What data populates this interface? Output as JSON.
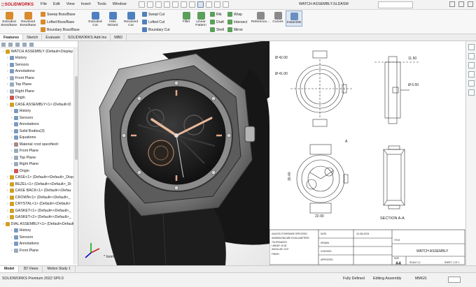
{
  "app": {
    "brand": "SOLIDWORKS",
    "doc_title": "WATCH ASSEMBLY.SLDASM"
  },
  "menu": [
    "File",
    "Edit",
    "View",
    "Insert",
    "Tools",
    "Window"
  ],
  "ribbon": {
    "large": [
      {
        "label": "Extruded Boss/Base",
        "color": "#d98a2c"
      },
      {
        "label": "Revolved Boss/Base",
        "color": "#d98a2c"
      },
      {
        "label": "Extruded Cut",
        "color": "#4f7fbf"
      },
      {
        "label": "Hole Wizard",
        "color": "#4f7fbf"
      },
      {
        "label": "Revolved Cut",
        "color": "#4f7fbf"
      },
      {
        "label": "Fillet",
        "color": "#5a9f5a"
      },
      {
        "label": "Linear Pattern",
        "color": "#5a9f5a"
      },
      {
        "label": "Reference...",
        "color": "#8a8a8a"
      },
      {
        "label": "Curves",
        "color": "#8a8a8a"
      },
      {
        "label": "Instant3D",
        "color": "#6a8fbf"
      }
    ],
    "small": [
      {
        "label": "Sweep Boss/Base",
        "color": "#d98a2c"
      },
      {
        "label": "Lofted Boss/Base",
        "color": "#d98a2c"
      },
      {
        "label": "Boundary Boss/Base",
        "color": "#d98a2c"
      },
      {
        "label": "Swept Cut",
        "color": "#4f7fbf"
      },
      {
        "label": "Lofted Cut",
        "color": "#4f7fbf"
      },
      {
        "label": "Boundary Cut",
        "color": "#4f7fbf"
      },
      {
        "label": "Rib",
        "color": "#5a9f5a"
      },
      {
        "label": "Draft",
        "color": "#5a9f5a"
      },
      {
        "label": "Shell",
        "color": "#5a9f5a"
      },
      {
        "label": "Wrap",
        "color": "#5a9f5a"
      },
      {
        "label": "Intersect",
        "color": "#5a9f5a"
      },
      {
        "label": "Mirror",
        "color": "#5a9f5a"
      }
    ]
  },
  "tabs": [
    "Features",
    "Sketch",
    "Evaluate",
    "SOLIDWORKS Add-Ins",
    "MBD"
  ],
  "tree": [
    {
      "label": "WATCH ASSEMBLY (Default<Display St",
      "indent": 0,
      "color": "#d0a020"
    },
    {
      "label": "History",
      "indent": 1,
      "color": "#7a9ac0"
    },
    {
      "label": "Sensors",
      "indent": 1,
      "color": "#7a9ac0"
    },
    {
      "label": "Annotations",
      "indent": 1,
      "color": "#7a9ac0"
    },
    {
      "label": "Front Plane",
      "indent": 1,
      "color": "#9ab"
    },
    {
      "label": "Top Plane",
      "indent": 1,
      "color": "#9ab"
    },
    {
      "label": "Right Plane",
      "indent": 1,
      "color": "#9ab"
    },
    {
      "label": "Origin",
      "indent": 1,
      "color": "#c55"
    },
    {
      "label": "CASE ASSEMBLY<1> (Default<D",
      "indent": 1,
      "color": "#d0a020"
    },
    {
      "label": "History",
      "indent": 2,
      "color": "#7a9ac0"
    },
    {
      "label": "Sensors",
      "indent": 2,
      "color": "#7a9ac0"
    },
    {
      "label": "Annotations",
      "indent": 2,
      "color": "#7a9ac0"
    },
    {
      "label": "Solid Bodies(3)",
      "indent": 2,
      "color": "#7a9ac0"
    },
    {
      "label": "Equations",
      "indent": 2,
      "color": "#7a9ac0"
    },
    {
      "label": "Material <not specified>",
      "indent": 2,
      "color": "#a88"
    },
    {
      "label": "Front Plane",
      "indent": 2,
      "color": "#9ab"
    },
    {
      "label": "Top Plane",
      "indent": 2,
      "color": "#9ab"
    },
    {
      "label": "Right Plane",
      "indent": 2,
      "color": "#9ab"
    },
    {
      "label": "Origin",
      "indent": 2,
      "color": "#c55"
    },
    {
      "label": "CASE<1> (Default<<Default>_Disp",
      "indent": 1,
      "color": "#d0a020"
    },
    {
      "label": "BEZEL<1> (Default<<Default>_Di",
      "indent": 1,
      "color": "#d0a020"
    },
    {
      "label": "CASE BACK<1> (Default<<Defau",
      "indent": 1,
      "color": "#d0a020"
    },
    {
      "label": "CROWN<1> (Default<<Default>_",
      "indent": 1,
      "color": "#d0a020"
    },
    {
      "label": "CRYSTAL<1> (Default<<Default>",
      "indent": 1,
      "color": "#d0a020"
    },
    {
      "label": "GASKET<1> (Default<<Default>_",
      "indent": 1,
      "color": "#d0a020"
    },
    {
      "label": "GASKET<2> (Default<<Default>_",
      "indent": 1,
      "color": "#d0a020"
    },
    {
      "label": "DIAL ASSEMBLY<1> (Default<Default",
      "indent": 0,
      "color": "#d0a020"
    },
    {
      "label": "History",
      "indent": 2,
      "color": "#7a9ac0"
    },
    {
      "label": "Sensors",
      "indent": 2,
      "color": "#7a9ac0"
    },
    {
      "label": "Annotations",
      "indent": 2,
      "color": "#7a9ac0"
    },
    {
      "label": "Front Plane",
      "indent": 2,
      "color": "#9ab"
    }
  ],
  "viewport": {
    "view_label": "* Isometric"
  },
  "drawing": {
    "dims": [
      "Ø 42.00",
      "Ø 41.00",
      "11.50",
      "Ø 6.50",
      "30.40",
      "22.00"
    ],
    "section_label": "SECTION A-A",
    "section_marker": "A",
    "titleblock": {
      "notes": [
        "UNLESS OTHERWISE SPECIFIED:",
        "DIMENSIONS ARE IN MILLIMETERS",
        "TOLERANCES:",
        "LINEAR: ±0.05",
        "ANGULAR: ±0.5°",
        "FINISH:"
      ],
      "rows": [
        "DRAWN",
        "CHECKED",
        "APPROVED"
      ],
      "date_header": "DATE",
      "date": "12-08-2024",
      "title_header": "TITLE",
      "title": "WATCH ASSEMBLY",
      "size_header": "SIZE",
      "size": "A4",
      "scale": "SCALE 1:1",
      "sheet": "SHEET 1 OF 1"
    }
  },
  "bottom_tabs": [
    "Model",
    "3D Views",
    "Motion Study 1"
  ],
  "status": {
    "left": "SOLIDWORKS Premium 2022 SP0.0",
    "defined": "Fully Defined",
    "mode": "Editing Assembly",
    "units": "MMGS"
  }
}
